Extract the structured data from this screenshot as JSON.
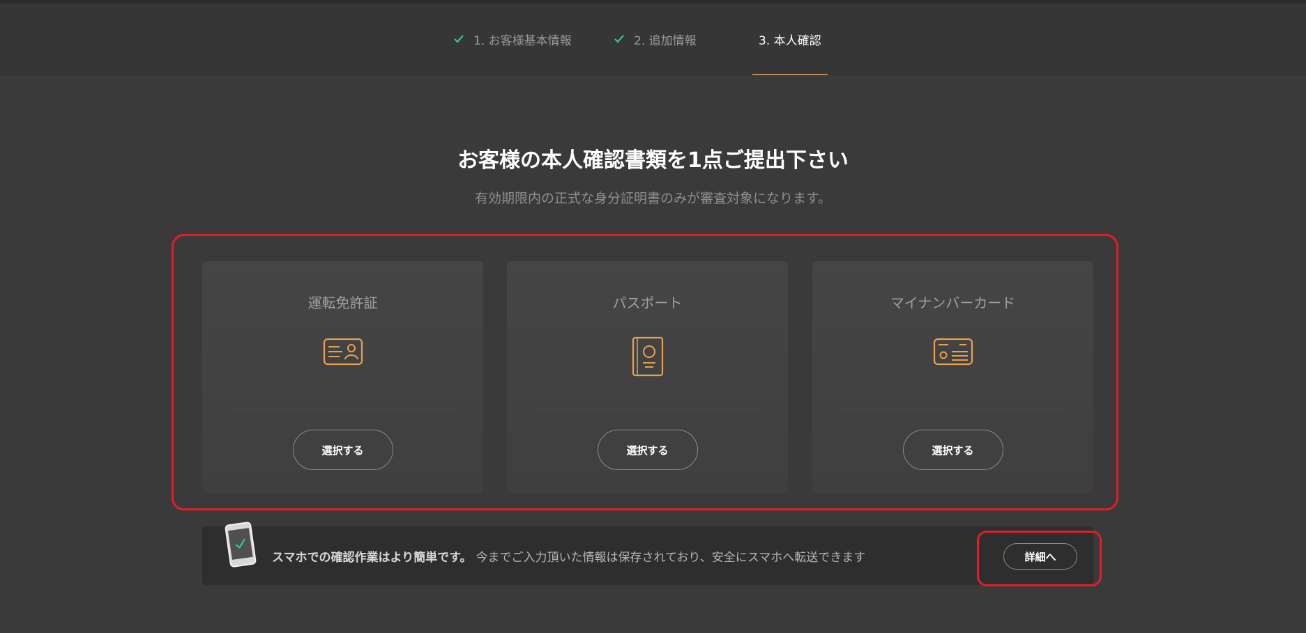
{
  "steps": [
    {
      "label": "1. お客様基本情報",
      "done": true
    },
    {
      "label": "2. 追加情報",
      "done": true
    },
    {
      "label": "3. 本人確認",
      "done": false
    }
  ],
  "main": {
    "title": "お客様の本人確認書類を1点ご提出下さい",
    "subtitle": "有効期限内の正式な身分証明書のみが審査対象になります。"
  },
  "cards": [
    {
      "title": "運転免許証",
      "icon": "drivers-license-icon",
      "button": "選択する"
    },
    {
      "title": "パスポート",
      "icon": "passport-icon",
      "button": "選択する"
    },
    {
      "title": "マイナンバーカード",
      "icon": "my-number-card-icon",
      "button": "選択する"
    }
  ],
  "notice": {
    "icon": "smartphone-check-icon",
    "bold": "スマホでの確認作業はより簡単です。",
    "text": "今までご入力頂いた情報は保存されており、安全にスマホへ転送できます",
    "button": "詳細へ"
  },
  "colors": {
    "accent": "#e8a14f",
    "check": "#2ecc8f",
    "highlight": "#e31e27",
    "active_underline": "#b8895b"
  }
}
